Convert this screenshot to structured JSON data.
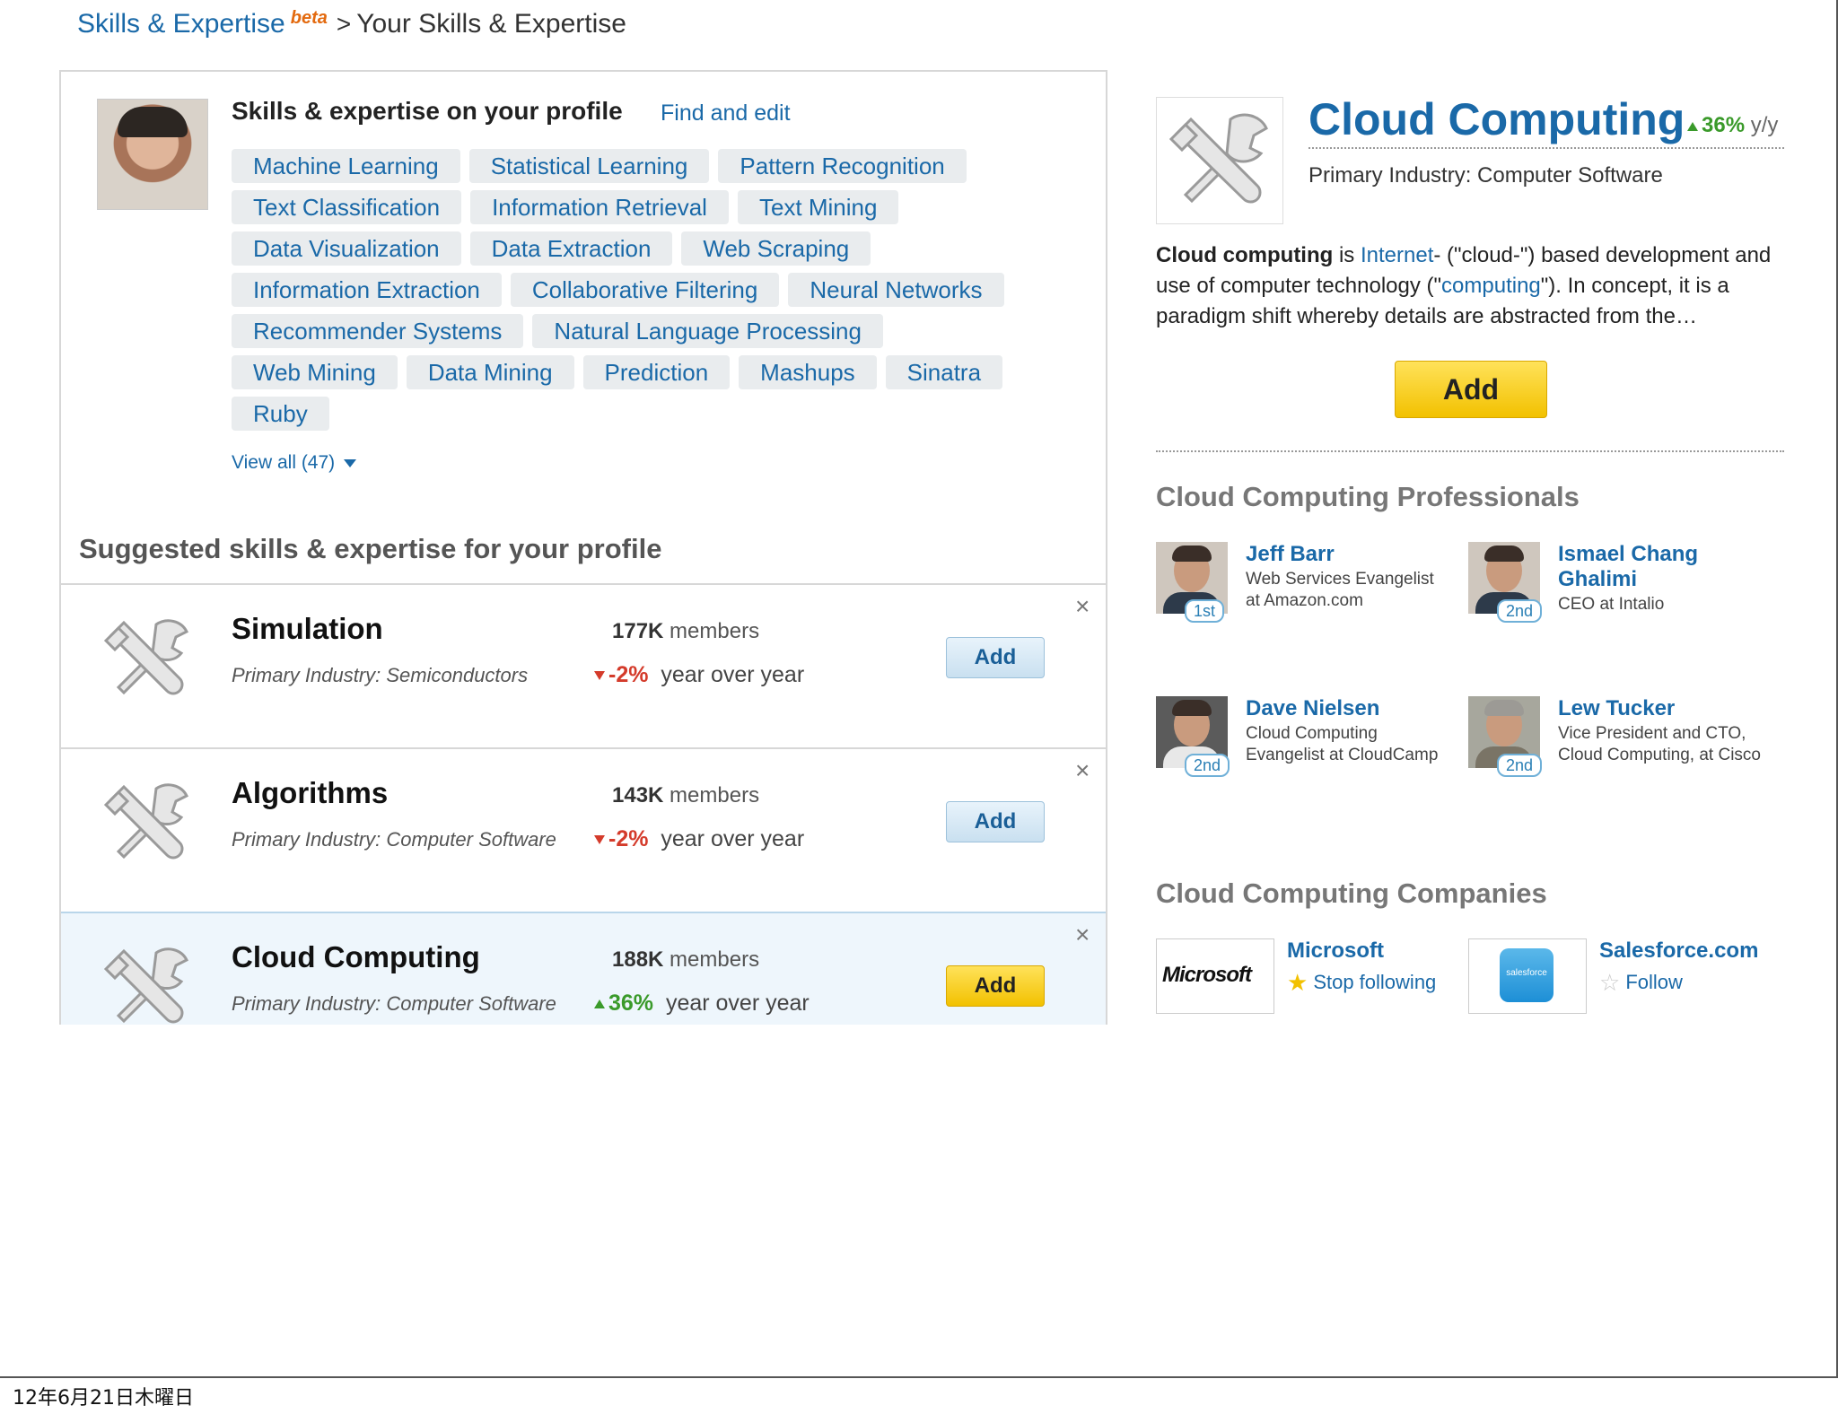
{
  "breadcrumb": {
    "root": "Skills & Expertise",
    "beta": "beta",
    "separator": ">",
    "current": "Your Skills & Expertise"
  },
  "profile_skills": {
    "heading": "Skills & expertise on your profile",
    "find_edit": "Find and edit",
    "rows": [
      [
        "Machine Learning",
        "Statistical Learning",
        "Pattern Recognition"
      ],
      [
        "Text Classification",
        "Information Retrieval",
        "Text Mining"
      ],
      [
        "Data Visualization",
        "Data Extraction",
        "Web Scraping"
      ],
      [
        "Information Extraction",
        "Collaborative Filtering",
        "Neural Networks"
      ],
      [
        "Recommender Systems",
        "Natural Language Processing"
      ],
      [
        "Web Mining",
        "Data Mining",
        "Prediction",
        "Mashups",
        "Sinatra"
      ],
      [
        "Ruby"
      ]
    ],
    "view_all": "View all (47)"
  },
  "suggested": {
    "heading": "Suggested skills & expertise for your profile",
    "items": [
      {
        "name": "Simulation",
        "industry": "Primary Industry: Semiconductors",
        "members_count": "177K",
        "members_label": "members",
        "growth": "-2%",
        "growth_label": "year over year",
        "direction": "down",
        "add": "Add",
        "close": "×"
      },
      {
        "name": "Algorithms",
        "industry": "Primary Industry: Computer Software",
        "members_count": "143K",
        "members_label": "members",
        "growth": "-2%",
        "growth_label": "year over year",
        "direction": "down",
        "add": "Add",
        "close": "×"
      },
      {
        "name": "Cloud Computing",
        "industry": "Primary Industry: Computer Software",
        "members_count": "188K",
        "members_label": "members",
        "growth": "36%",
        "growth_label": "year over year",
        "direction": "up",
        "add": "Add",
        "close": "×"
      }
    ]
  },
  "detail": {
    "title": "Cloud Computing",
    "trend": "36%",
    "trend_suffix": "y/y",
    "industry": "Primary Industry: Computer Software",
    "desc_bold": "Cloud computing",
    "desc_is": " is ",
    "desc_link1": "Internet",
    "desc_mid": "- (\"cloud-\") based development and use of computer technology (\"",
    "desc_link2": "computing",
    "desc_end": "\"). In concept, it is a paradigm shift whereby details are abstracted from the…",
    "add": "Add",
    "professionals_heading": "Cloud Computing Professionals",
    "professionals": [
      {
        "name": "Jeff Barr",
        "title": "Web Services Evangelist at Amazon.com",
        "degree": "1st"
      },
      {
        "name": "Ismael Chang Ghalimi",
        "title": "CEO at Intalio",
        "degree": "2nd"
      },
      {
        "name": "Dave Nielsen",
        "title": "Cloud Computing Evangelist at CloudCamp",
        "degree": "2nd"
      },
      {
        "name": "Lew Tucker",
        "title": "Vice President and CTO, Cloud Computing, at Cisco",
        "degree": "2nd"
      }
    ],
    "companies_heading": "Cloud Computing Companies",
    "companies": [
      {
        "name": "Microsoft",
        "logo_text": "Microsoft",
        "action": "Stop following"
      },
      {
        "name": "Salesforce.com",
        "logo_text": "salesforce",
        "action": "Follow"
      }
    ]
  },
  "footer": {
    "date": "12年6月21日木曜日"
  },
  "colors": {
    "link": "#1a69a8",
    "add_yellow": "#f2c100",
    "growth_up": "#3a9a2a",
    "growth_down": "#d43b2b"
  }
}
